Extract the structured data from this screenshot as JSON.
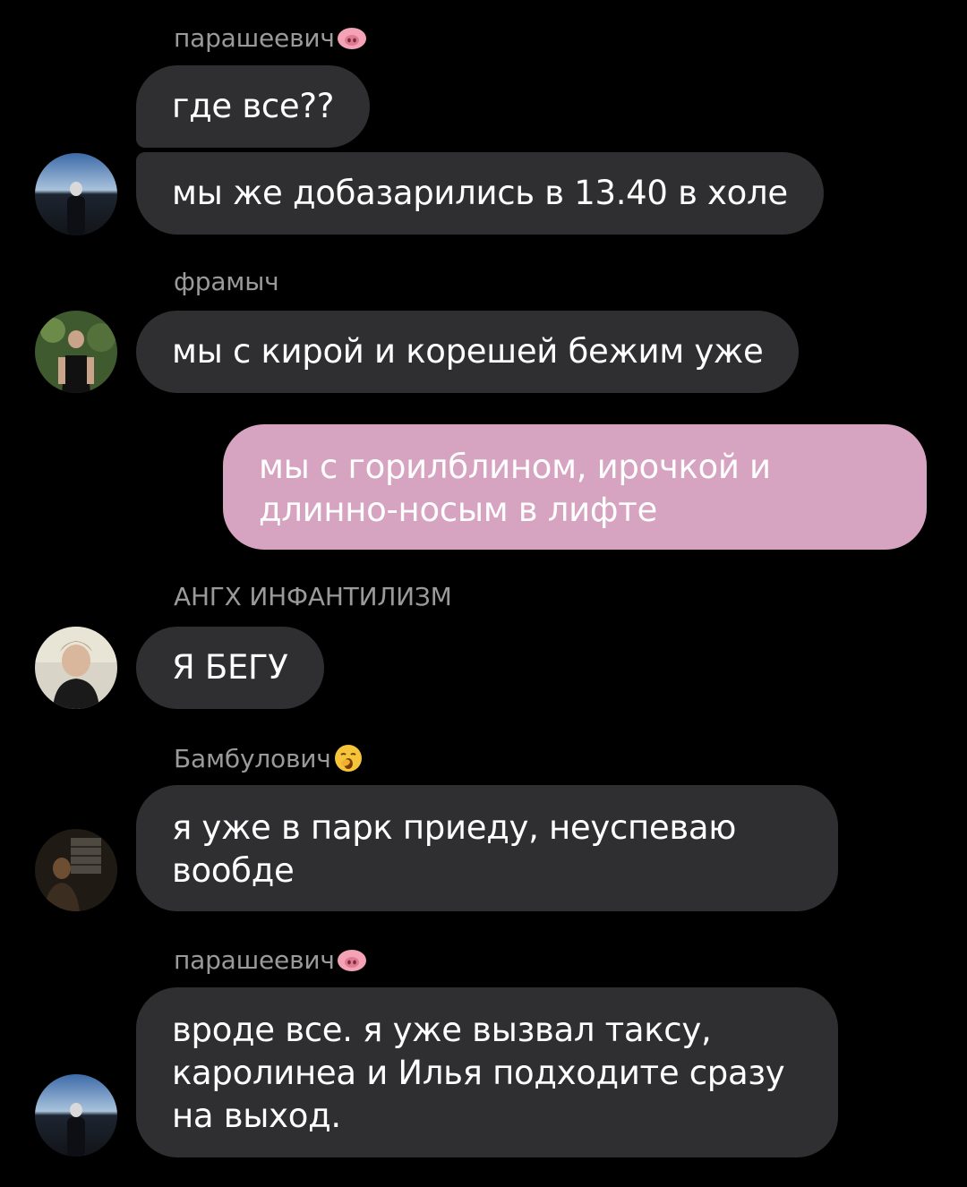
{
  "chat": {
    "groups": [
      {
        "sender": "парашеевич",
        "sender_emoji": "pig-face-icon",
        "messages": [
          "где все??",
          "мы же добазарились в 13.40 в холе"
        ]
      },
      {
        "sender": "фрамыч",
        "messages": [
          "мы с кирой и корешей бежим уже"
        ]
      },
      {
        "outgoing": true,
        "messages": [
          "мы с горилблином, ирочкой и длинно-носым в лифте"
        ]
      },
      {
        "sender": "АНГХ ИНФАНТИЛИЗМ",
        "messages": [
          "Я БЕГУ"
        ]
      },
      {
        "sender": "Бамбулович",
        "sender_emoji": "yawning-face-icon",
        "messages": [
          "я уже в парк приеду, неуспеваю вообде"
        ]
      },
      {
        "sender": "парашеевич",
        "sender_emoji": "pig-face-icon",
        "messages": [
          "вроде все. я уже вызвал таксу, каролинеа и Илья подходите сразу на выход."
        ]
      }
    ]
  },
  "colors": {
    "background": "#000000",
    "incoming_bubble": "#2f2f31",
    "outgoing_bubble": "#d6a3c1",
    "sender_name": "#9a9a9a"
  }
}
